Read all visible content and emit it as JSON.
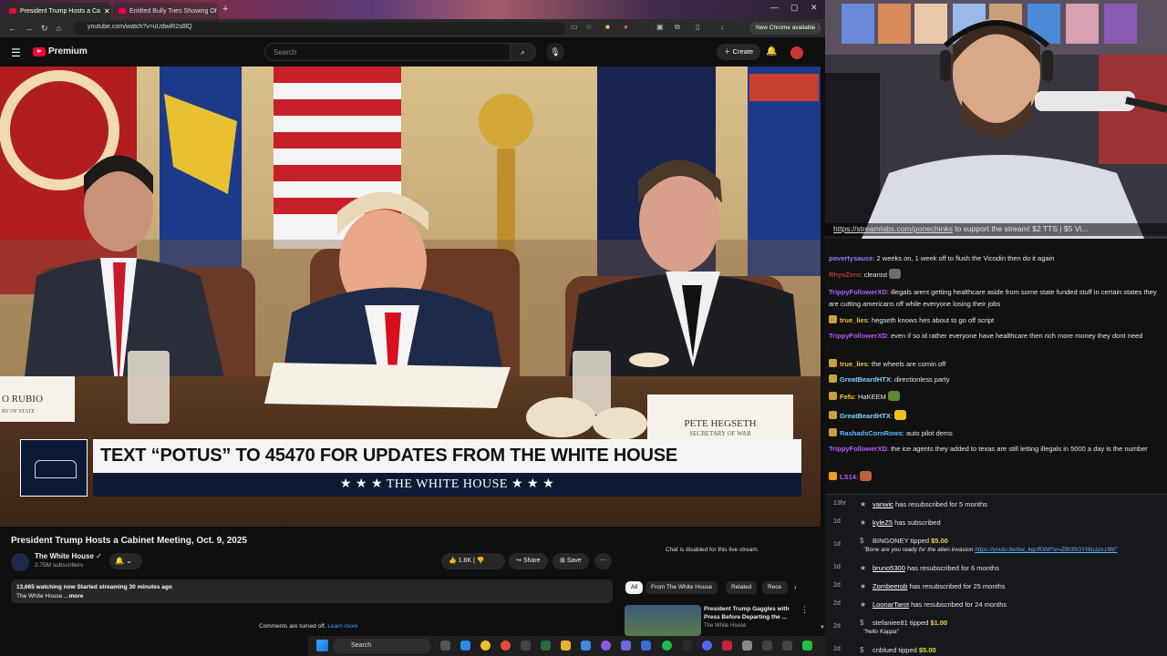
{
  "browser": {
    "tabs": [
      {
        "title": "President Trump Hosts a Ca",
        "active": true
      },
      {
        "title": "Entitled Bully Tries Showing Of",
        "active": false
      }
    ],
    "url": "youtube.com/watch?v=uUdwiR2s8lQ",
    "new_chrome": "New Chrome available"
  },
  "yt": {
    "logo": "Premium",
    "search_placeholder": "Search",
    "create": "Create"
  },
  "video": {
    "banner_text": "TEXT “POTUS” TO 45470 FOR UPDATES FROM THE WHITE HOUSE",
    "banner_sub": "★ ★ ★  THE WHITE HOUSE  ★ ★ ★",
    "placard_left": "O RUBIO",
    "placard_left_sub": "RY OF STATE",
    "placard_right": "PETE HEGSETH",
    "placard_right_sub": "SECRETARY OF WAR"
  },
  "meta": {
    "title": "President Trump Hosts a Cabinet Meeting, Oct. 9, 2025",
    "channel": "The White House",
    "subs": "2.75M subscribers",
    "likes": "1.6K",
    "share": "Share",
    "save": "Save",
    "stats": "13,665 watching now  Started streaming 30 minutes ago",
    "desc": "The White House ...",
    "more": "more",
    "comments_off": "Comments are turned off.",
    "learn_more": "Learn more",
    "chat_disabled": "Chat is disabled for this live stream.",
    "chips": [
      "All",
      "From The White House",
      "Related",
      "Rece"
    ],
    "rec_title": "President Trump Gaggles with Press Before Departing the ...",
    "rec_channel": "The White House"
  },
  "stream": {
    "ticker_link": "https://streamlabs.com/ponechinks",
    "ticker_rest": " to support the stream! $2 TTS | $5 Vi..."
  },
  "chat": [
    {
      "user": "povertysauce",
      "color": "#9b7bff",
      "text": "2 weeks on, 1 week off to flush the Vicodin then do it again",
      "badge": ""
    },
    {
      "user": "RhysZero",
      "color": "#c0392b",
      "text": "cleanist",
      "badge": "",
      "emote": true
    },
    {
      "user": "TrippyFollowerXD",
      "color": "#b45cff",
      "text": "illegals arent getting healthcare aside from some state funded stuff in certain states they are cutting americans off while everyone losing their jobs",
      "badge": ""
    },
    {
      "user": "true_lies",
      "color": "#f0c040",
      "text": "hegseth knows hes about to go off script",
      "badge": "#c8a040"
    },
    {
      "user": "TrippyFollowerXD",
      "color": "#b45cff",
      "text": "even if so id rather everyone have healthcare then rich more money they dont need",
      "badge": ""
    },
    {
      "user": "true_lies",
      "color": "#f0c040",
      "text": "the wheels are comin off",
      "badge": "#c8a040"
    },
    {
      "user": "GreatBeardHTX",
      "color": "#7fd4ff",
      "text": "directionless party",
      "badge": "#c8a040"
    },
    {
      "user": "Fefu",
      "color": "#ffcc33",
      "text": "HaKEEM",
      "badge": "#c8a040",
      "emote": true
    },
    {
      "user": "GreatBeardHTX",
      "color": "#7fd4ff",
      "text": "",
      "badge": "#c8a040",
      "emote": true
    },
    {
      "user": "RashadsCornRows",
      "color": "#5fb8ff",
      "text": "auto pilot dems",
      "badge": "#c8a040"
    },
    {
      "user": "TrippyFollowerXD",
      "color": "#b45cff",
      "text": "the ice agents they added to texas are still letting illegals in 5000 a day is the number",
      "badge": ""
    },
    {
      "user": "LS14",
      "color": "#b45cff",
      "text": "",
      "badge": "#e8a020",
      "emote": true
    }
  ],
  "events": [
    {
      "time": "13hr",
      "user": "vanwic",
      "text": " has resubscribed for 5 months"
    },
    {
      "time": "1d",
      "user": "kyleZ5",
      "text": " has subscribed"
    },
    {
      "time": "1d",
      "user": "BINGONEY",
      "text": " tipped ",
      "amount": "$5.00",
      "quote": "\"Bone are you ready for the alien invasion ",
      "link": "https://youtu.be/bw_kgcff0lM?si=ZBI35GYWu1ps1f80\""
    },
    {
      "time": "1d",
      "user": "bruno5300",
      "text": " has resubscribed for 6 months"
    },
    {
      "time": "2d",
      "user": "Zombeerob",
      "text": " has resubscribed for 25 months"
    },
    {
      "time": "2d",
      "user": "LoonarTarot",
      "text": " has resubscribed for 24 months"
    },
    {
      "time": "2d",
      "user": "stefaniee81",
      "text": " tipped ",
      "amount": "$1.00",
      "quote": "\"hello Kappa\""
    },
    {
      "time": "2d",
      "user": "cnblued",
      "text": " tipped ",
      "amount": "$5.00"
    }
  ],
  "taskbar": {
    "search": "Search"
  }
}
